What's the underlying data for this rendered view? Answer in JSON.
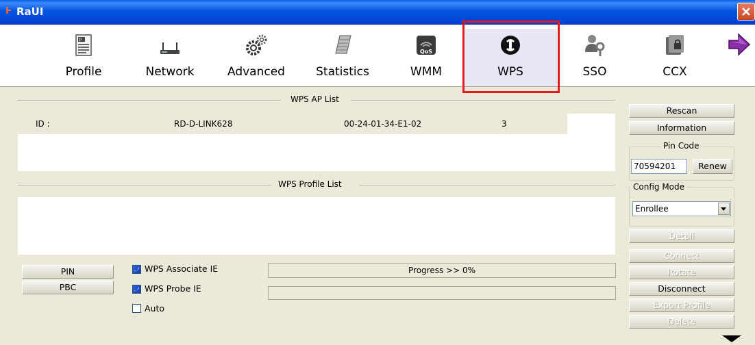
{
  "window": {
    "title": "RaUI",
    "logo_glyph": "Ⱶ"
  },
  "toolbar": {
    "items": [
      {
        "label": "Profile",
        "icon": "profile-icon"
      },
      {
        "label": "Network",
        "icon": "network-icon"
      },
      {
        "label": "Advanced",
        "icon": "advanced-icon"
      },
      {
        "label": "Statistics",
        "icon": "statistics-icon"
      },
      {
        "label": "WMM",
        "icon": "wmm-icon"
      },
      {
        "label": "WPS",
        "icon": "wps-icon",
        "selected": true
      },
      {
        "label": "SSO",
        "icon": "sso-icon"
      },
      {
        "label": "CCX",
        "icon": "ccx-icon"
      }
    ],
    "more_icon": "arrow-right-icon",
    "qos_text": "QoS"
  },
  "wps_ap_list": {
    "title": "WPS AP List",
    "row": {
      "id_label": "ID :",
      "ssid": "RD-D-LINK628",
      "bssid": "00-24-01-34-E1-02",
      "channel": "3"
    }
  },
  "wps_profile_list": {
    "title": "WPS Profile List"
  },
  "buttons": {
    "pin": "PIN",
    "pbc": "PBC",
    "rescan": "Rescan",
    "information": "Information",
    "renew": "Renew",
    "detail": "Detail",
    "connect": "Connect",
    "rotate": "Rotate",
    "disconnect": "Disconnect",
    "export_profile": "Export Profile",
    "delete": "Delete"
  },
  "pin_code": {
    "title": "Pin Code",
    "value": "70594201"
  },
  "config_mode": {
    "title": "Config Mode",
    "selected": "Enrollee"
  },
  "options": {
    "associate_ie": {
      "label": "WPS Associate IE",
      "checked": true
    },
    "probe_ie": {
      "label": "WPS Probe IE",
      "checked": true
    },
    "auto": {
      "label": "Auto",
      "checked": false
    }
  },
  "progress": {
    "text": "Progress >> 0%",
    "value_percent": 0
  },
  "colors": {
    "titlebar": "#0653df",
    "highlight": "#e0191c",
    "window_bg": "#ece9d8"
  }
}
